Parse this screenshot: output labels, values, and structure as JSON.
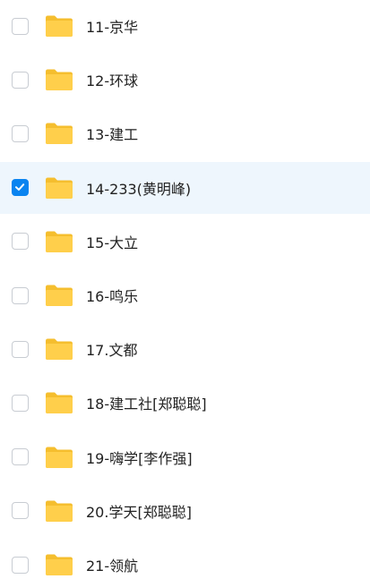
{
  "colors": {
    "folder": "#FFCF4B",
    "folder_tab": "#F5BE2E",
    "check_accent": "#0A84F0",
    "selected_row_bg": "#EEF6FD"
  },
  "icons": {
    "folder": "folder-icon",
    "checkbox": "checkbox-icon",
    "checkmark": "checkmark-icon"
  },
  "files": [
    {
      "name": "11-京华",
      "checked": false
    },
    {
      "name": "12-环球",
      "checked": false
    },
    {
      "name": "13-建工",
      "checked": false
    },
    {
      "name": "14-233(黄明峰)",
      "checked": true
    },
    {
      "name": "15-大立",
      "checked": false
    },
    {
      "name": "16-鸣乐",
      "checked": false
    },
    {
      "name": "17.文都",
      "checked": false
    },
    {
      "name": "18-建工社[郑聪聪]",
      "checked": false
    },
    {
      "name": "19-嗨学[李作强]",
      "checked": false
    },
    {
      "name": "20.学天[郑聪聪]",
      "checked": false
    },
    {
      "name": "21-领航",
      "checked": false
    }
  ]
}
